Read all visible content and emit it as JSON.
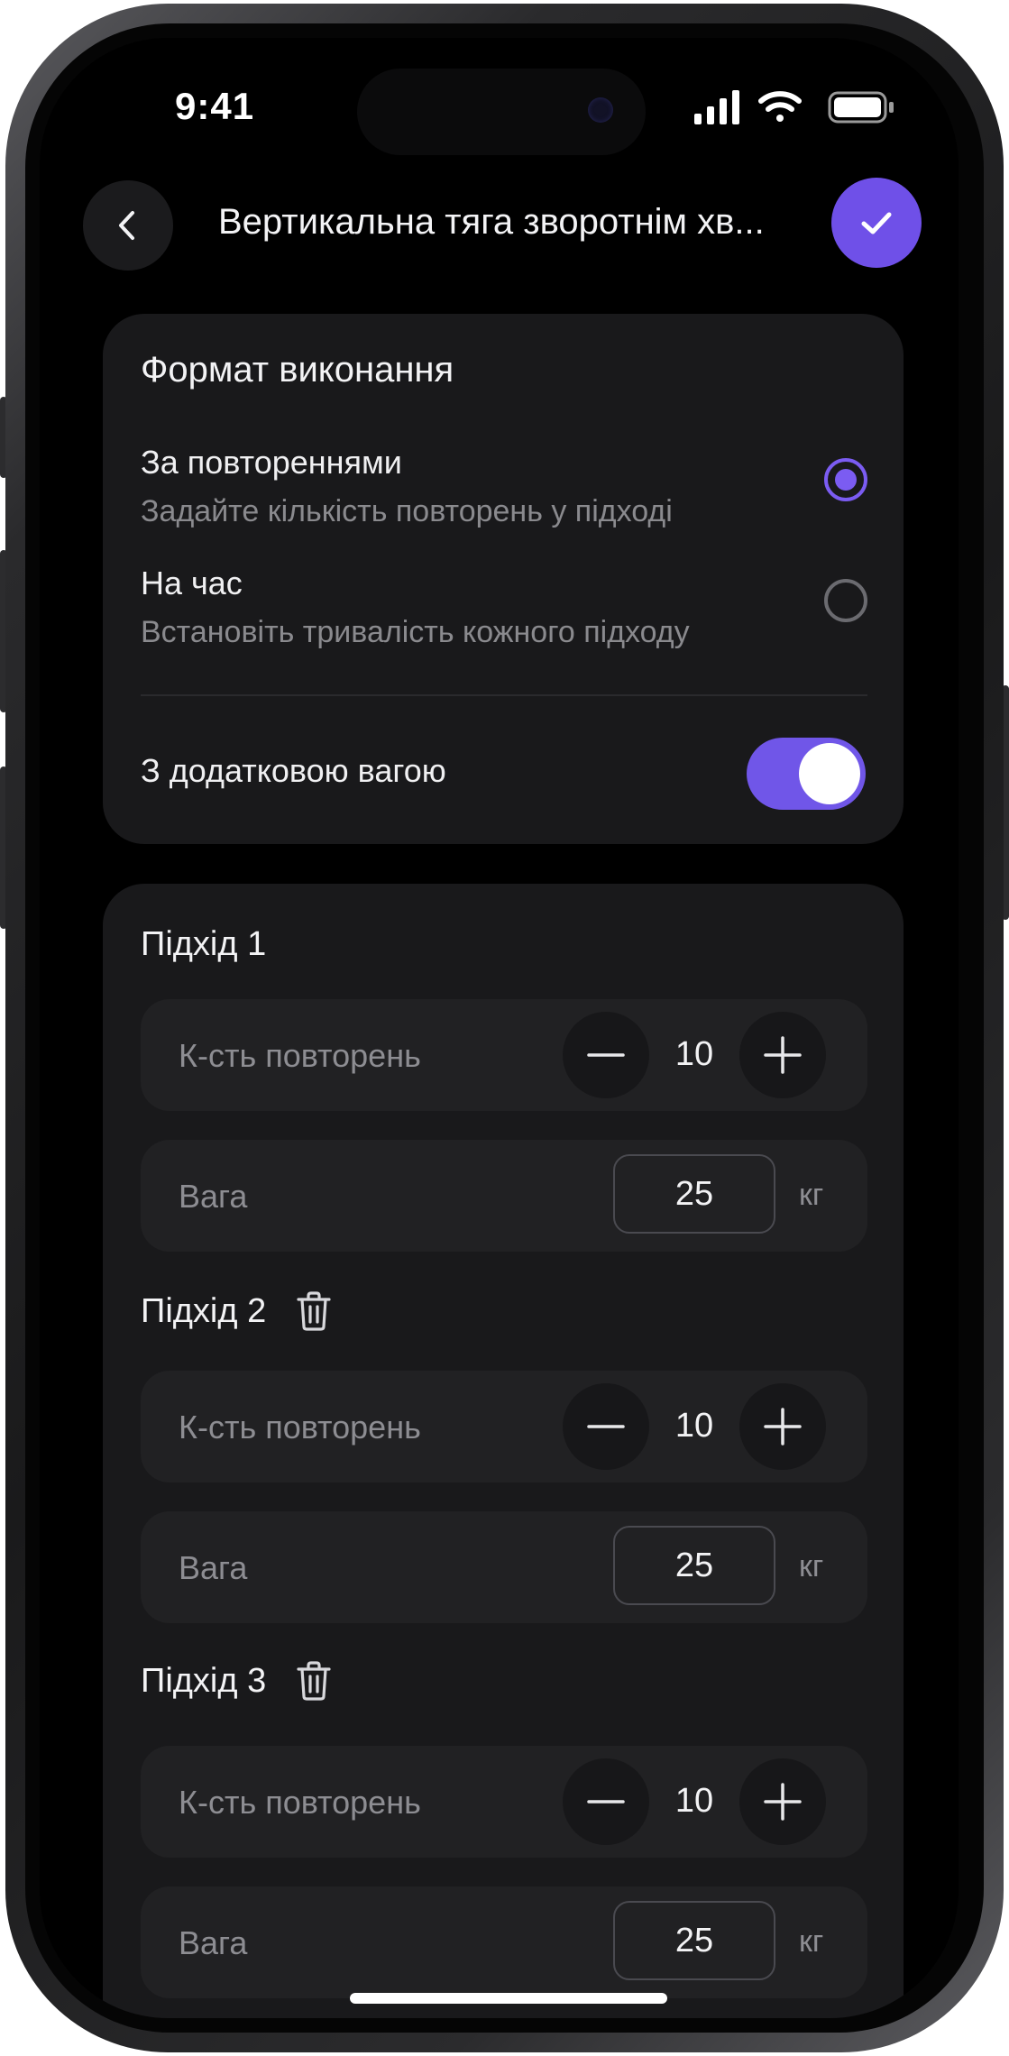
{
  "status": {
    "time": "9:41"
  },
  "header": {
    "title": "Вертикальна тяга зворотнім хв..."
  },
  "format": {
    "heading": "Формат виконання",
    "options": [
      {
        "title": "За повтореннями",
        "desc": "Задайте кількість повторень у підході",
        "selected": true
      },
      {
        "title": "На час",
        "desc": "Встановіть тривалість кожного підходу",
        "selected": false
      }
    ],
    "extra_weight": {
      "label": "З додатковою вагою",
      "on": true
    }
  },
  "sets": [
    {
      "title": "Підхід 1",
      "reps_label": "К-сть повторень",
      "reps": "10",
      "weight_label": "Вага",
      "weight": "25",
      "unit": "кг",
      "deletable": false
    },
    {
      "title": "Підхід 2",
      "reps_label": "К-сть повторень",
      "reps": "10",
      "weight_label": "Вага",
      "weight": "25",
      "unit": "кг",
      "deletable": true
    },
    {
      "title": "Підхід 3",
      "reps_label": "К-сть повторень",
      "reps": "10",
      "weight_label": "Вага",
      "weight": "25",
      "unit": "кг",
      "deletable": true
    }
  ],
  "colors": {
    "accent": "#7056e8",
    "background": "#000000",
    "card": "#19191b"
  }
}
